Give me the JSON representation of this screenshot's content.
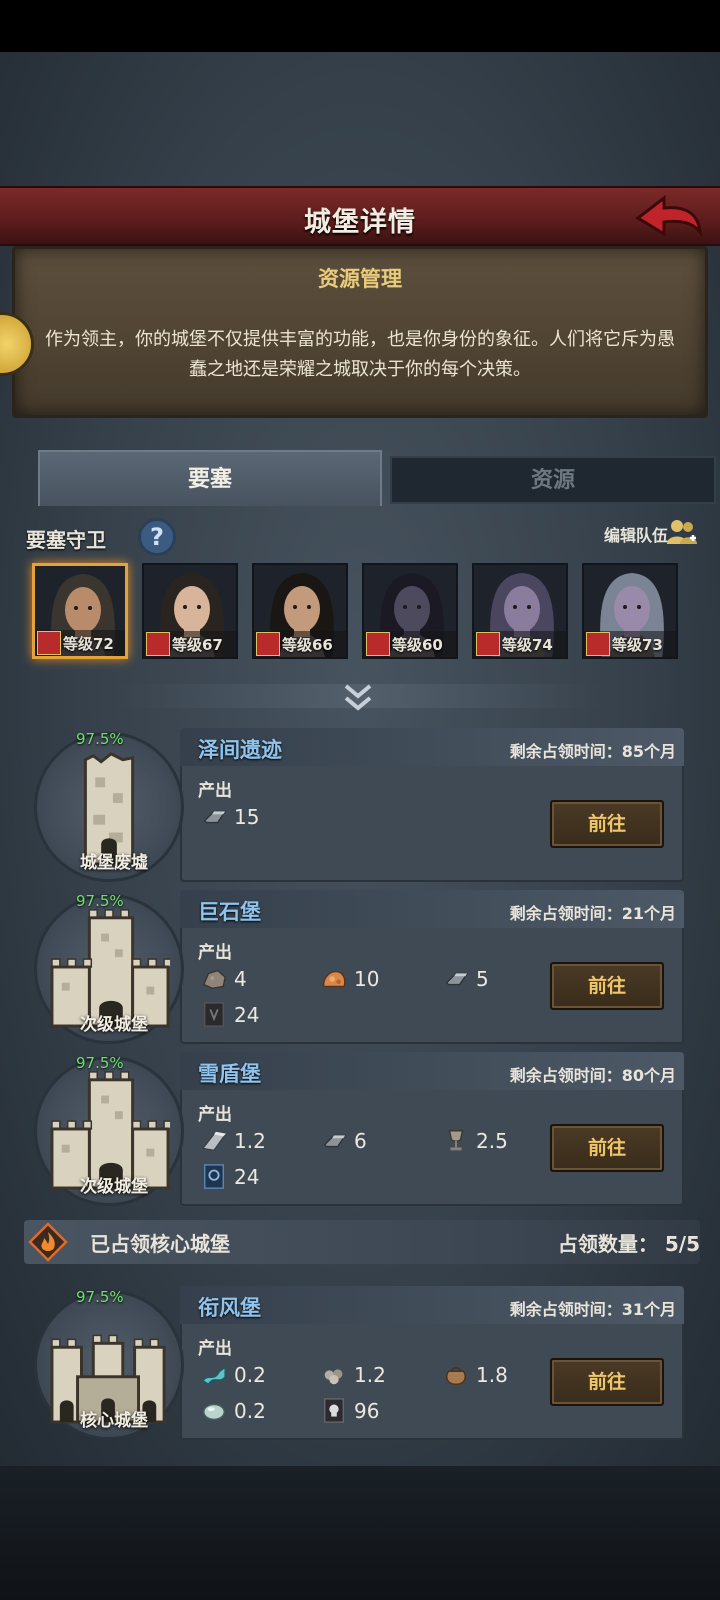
{
  "header": {
    "title": "城堡详情"
  },
  "intro": {
    "title": "资源管理",
    "text": "作为领主，你的城堡不仅提供丰富的功能，也是你身份的象征。人们将它斥为愚蠢之地还是荣耀之城取决于你的每个决策。"
  },
  "tabs": [
    {
      "label": "要塞",
      "active": true
    },
    {
      "label": "资源",
      "active": false
    }
  ],
  "guard": {
    "title": "要塞守卫",
    "help_icon": "?",
    "edit_label": "编辑队伍",
    "heroes": [
      {
        "level": "等级72",
        "selected": true,
        "skin": "#b88c6a",
        "hair": "#3b3530"
      },
      {
        "level": "等级67",
        "selected": false,
        "skin": "#d8b49a",
        "hair": "#2a2420"
      },
      {
        "level": "等级66",
        "selected": false,
        "skin": "#c49a7c",
        "hair": "#1a1614"
      },
      {
        "level": "等级60",
        "selected": false,
        "skin": "#4e4a5e",
        "hair": "#1b1a24"
      },
      {
        "level": "等级74",
        "selected": false,
        "skin": "#8a7c9c",
        "hair": "#4a4660"
      },
      {
        "level": "等级73",
        "selected": false,
        "skin": "#9a8aaa",
        "hair": "#7a8494"
      }
    ]
  },
  "castles": [
    {
      "pct": "97.5%",
      "type": "城堡废墟",
      "name": "泽间遗迹",
      "remain": "剩余占领时间：85个月",
      "output_label": "产出",
      "go": "前往",
      "resources": [
        {
          "icon": "iron-bar-icon",
          "value": "15"
        }
      ]
    },
    {
      "pct": "97.5%",
      "type": "次级城堡",
      "name": "巨石堡",
      "remain": "剩余占领时间：21个月",
      "output_label": "产出",
      "go": "前往",
      "resources": [
        {
          "icon": "stone-icon",
          "value": "4"
        },
        {
          "icon": "copper-ore-icon",
          "value": "10"
        },
        {
          "icon": "iron-bar-icon",
          "value": "5"
        },
        {
          "icon": "dark-banner-icon",
          "value": "24"
        }
      ]
    },
    {
      "pct": "97.5%",
      "type": "次级城堡",
      "name": "雪盾堡",
      "remain": "剩余占领时间：80个月",
      "output_label": "产出",
      "go": "前往",
      "resources": [
        {
          "icon": "steel-bar-icon",
          "value": "1.2"
        },
        {
          "icon": "iron-bar-icon",
          "value": "6"
        },
        {
          "icon": "goblet-icon",
          "value": "2.5"
        },
        {
          "icon": "blue-banner-icon",
          "value": "24"
        }
      ]
    }
  ],
  "core_section": {
    "title": "已占领核心城堡",
    "count": "占领数量：  5/5"
  },
  "core_castle": {
    "pct": "97.5%",
    "type": "核心城堡",
    "name": "衔风堡",
    "remain": "剩余占领时间：31个月",
    "output_label": "产出",
    "go": "前往",
    "resources": [
      {
        "icon": "cloth-icon",
        "value": "0.2"
      },
      {
        "icon": "gems-icon",
        "value": "1.2"
      },
      {
        "icon": "pouch-icon",
        "value": "1.8"
      },
      {
        "icon": "moonstone-icon",
        "value": "0.2"
      },
      {
        "icon": "skull-banner-icon",
        "value": "96"
      }
    ]
  },
  "colors": {
    "accent": "#8fc4ee",
    "percent": "#6fe06f",
    "header": "#6a2222",
    "button_text": "#f0c66a"
  }
}
